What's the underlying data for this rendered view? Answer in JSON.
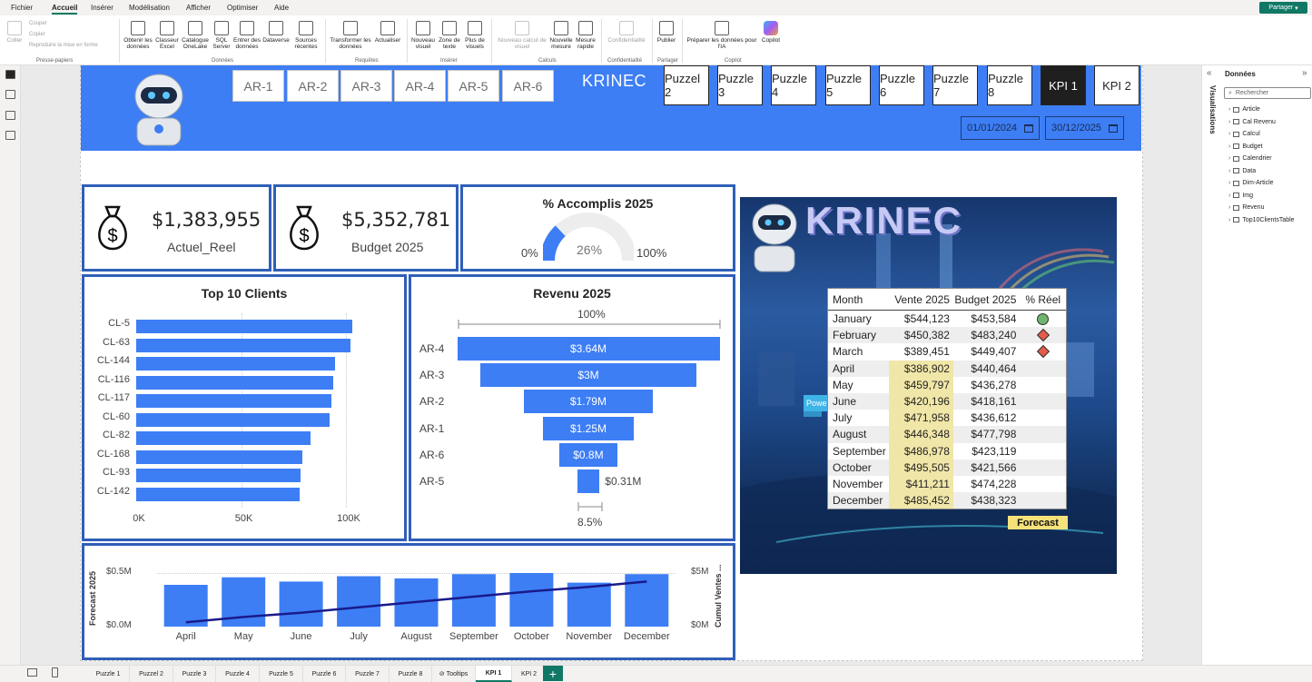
{
  "menu": {
    "items": [
      {
        "label": "Fichier",
        "active": false
      },
      {
        "label": "Accueil",
        "active": true
      },
      {
        "label": "Insérer",
        "active": false
      },
      {
        "label": "Modélisation",
        "active": false
      },
      {
        "label": "Afficher",
        "active": false
      },
      {
        "label": "Optimiser",
        "active": false
      },
      {
        "label": "Aide",
        "active": false
      }
    ],
    "share_label": "Partager"
  },
  "ribbon": {
    "paste": "Coller",
    "cut": "Couper",
    "copy": "Copier",
    "format_painter": "Reproduire la mise en forme",
    "buttons": [
      {
        "label": "Obtenir les données",
        "icon": "database-icon"
      },
      {
        "label": "Classeur Excel",
        "icon": "excel-icon"
      },
      {
        "label": "Catalogue OneLake",
        "icon": "onelake-icon"
      },
      {
        "label": "SQL Server",
        "icon": "sql-icon"
      },
      {
        "label": "Entrer des données",
        "icon": "table-icon"
      },
      {
        "label": "Dataverse",
        "icon": "dataverse-icon"
      },
      {
        "label": "Sources récentes",
        "icon": "recent-icon"
      },
      {
        "label": "Transformer les données",
        "icon": "transform-icon"
      },
      {
        "label": "Actualiser",
        "icon": "refresh-icon"
      },
      {
        "label": "Nouveau visuel",
        "icon": "chart-icon"
      },
      {
        "label": "Zone de texte",
        "icon": "textbox-icon"
      },
      {
        "label": "Plus de visuels",
        "icon": "more-visuals-icon"
      },
      {
        "label": "Nouveau calcul de visuel",
        "icon": "calc-icon"
      },
      {
        "label": "Nouvelle mesure",
        "icon": "measure-icon"
      },
      {
        "label": "Mesure rapide",
        "icon": "quick-measure-icon"
      },
      {
        "label": "Confidentialité",
        "icon": "shield-icon"
      },
      {
        "label": "Publier",
        "icon": "publish-icon"
      },
      {
        "label": "Préparer les données pour l'IA",
        "icon": "ai-prep-icon"
      },
      {
        "label": "Copilot",
        "icon": "copilot-icon"
      }
    ],
    "groups": [
      "Presse-papiers",
      "Données",
      "Requêtes",
      "Insérer",
      "Calculs",
      "Confidentialité",
      "Partager",
      "Copilot"
    ]
  },
  "header": {
    "ar_buttons": [
      "AR-1",
      "AR-2",
      "AR-3",
      "AR-4",
      "AR-5",
      "AR-6"
    ],
    "brand": "KRINEC",
    "nav_buttons": [
      "Puzzel 2",
      "Puzzle 3",
      "Puzzle 4",
      "Puzzle 5",
      "Puzzle 6",
      "Puzzle 7",
      "Puzzle 8",
      "KPI 1",
      "KPI 2"
    ],
    "active_nav": "KPI 1",
    "date_start": "01/01/2024",
    "date_end": "30/12/2025"
  },
  "cards": {
    "actual_value": "$1,383,955",
    "actual_label": "Actuel_Reel",
    "budget_value": "$5,352,781",
    "budget_label": "Budget 2025"
  },
  "gauge": {
    "title": "% Accomplis 2025",
    "min_label": "0%",
    "max_label": "100%",
    "value_label": "26%",
    "value_fraction": 0.26
  },
  "image_panel": {
    "brand": "KRINEC",
    "forecast_label": "Forecast",
    "power_label": "Powe"
  },
  "table": {
    "headers": [
      "Month",
      "Vente 2025",
      "Budget 2025",
      "% Réel"
    ],
    "rows": [
      {
        "month": "January",
        "vente": "$544,123",
        "budget": "$453,584",
        "indicator": "green-circle",
        "highlight": false
      },
      {
        "month": "February",
        "vente": "$450,382",
        "budget": "$483,240",
        "indicator": "red-diamond",
        "highlight": false
      },
      {
        "month": "March",
        "vente": "$389,451",
        "budget": "$449,407",
        "indicator": "red-diamond",
        "highlight": false
      },
      {
        "month": "April",
        "vente": "$386,902",
        "budget": "$440,464",
        "indicator": "",
        "highlight": true
      },
      {
        "month": "May",
        "vente": "$459,797",
        "budget": "$436,278",
        "indicator": "",
        "highlight": true
      },
      {
        "month": "June",
        "vente": "$420,196",
        "budget": "$418,161",
        "indicator": "",
        "highlight": true
      },
      {
        "month": "July",
        "vente": "$471,958",
        "budget": "$436,612",
        "indicator": "",
        "highlight": true
      },
      {
        "month": "August",
        "vente": "$446,348",
        "budget": "$477,798",
        "indicator": "",
        "highlight": true
      },
      {
        "month": "September",
        "vente": "$486,978",
        "budget": "$423,119",
        "indicator": "",
        "highlight": true
      },
      {
        "month": "October",
        "vente": "$495,505",
        "budget": "$421,566",
        "indicator": "",
        "highlight": true
      },
      {
        "month": "November",
        "vente": "$411,211",
        "budget": "$474,228",
        "indicator": "",
        "highlight": true
      },
      {
        "month": "December",
        "vente": "$485,452",
        "budget": "$438,323",
        "indicator": "",
        "highlight": true
      }
    ]
  },
  "chart_data": [
    {
      "type": "bar",
      "orientation": "horizontal",
      "title": "Top 10 Clients",
      "categories": [
        "CL-5",
        "CL-63",
        "CL-144",
        "CL-116",
        "CL-117",
        "CL-60",
        "CL-82",
        "CL-168",
        "CL-93",
        "CL-142"
      ],
      "values": [
        103000,
        102000,
        95000,
        94000,
        93000,
        92000,
        83000,
        79000,
        78500,
        78000
      ],
      "xlim": [
        0,
        100000
      ],
      "xticks": [
        "0K",
        "50K",
        "100K"
      ]
    },
    {
      "type": "bar",
      "orientation": "funnel",
      "title": "Revenu 2025",
      "categories": [
        "AR-4",
        "AR-3",
        "AR-2",
        "AR-1",
        "AR-6",
        "AR-5"
      ],
      "values": [
        3.64,
        3.0,
        1.79,
        1.25,
        0.8,
        0.31
      ],
      "labels": [
        "$3.64M",
        "$3M",
        "$1.79M",
        "$1.25M",
        "$0.8M",
        "$0.31M"
      ],
      "top_percent": "100%",
      "bottom_percent": "8.5%"
    },
    {
      "type": "bar",
      "title": "",
      "categories": [
        "April",
        "May",
        "June",
        "July",
        "August",
        "September",
        "October",
        "November",
        "December"
      ],
      "series": [
        {
          "name": "Forecast 2025",
          "values": [
            0.39,
            0.46,
            0.42,
            0.47,
            0.45,
            0.49,
            0.5,
            0.41,
            0.49
          ]
        },
        {
          "name": "Cumul Ventes ...",
          "values": [
            0.4,
            0.9,
            1.3,
            1.8,
            2.3,
            2.8,
            3.3,
            3.7,
            4.2
          ]
        }
      ],
      "ylabel": "Forecast 2025",
      "y2label": "Cumul Ventes ...",
      "yticks": [
        "$0.0M",
        "$0.5M"
      ],
      "y2ticks": [
        "$0M",
        "$5M"
      ],
      "ylim": [
        0,
        0.5
      ],
      "y2lim": [
        0,
        5
      ]
    }
  ],
  "right_pane": {
    "vertical_label": "Visualisations",
    "title": "Données",
    "search_placeholder": "Rechercher",
    "fields": [
      "Article",
      "Cal Revenu",
      "Calcul",
      "Budget",
      "Calendrier",
      "Data",
      "Dim-Article",
      "Img",
      "Revenu",
      "Top10ClientsTable"
    ]
  },
  "tabs": {
    "items": [
      "Puzzle 1",
      "Puzzel 2",
      "Puzzle 3",
      "Puzzle 4",
      "Puzzle 5",
      "Puzzle 6",
      "Puzzle 7",
      "Puzzle 8",
      "Tooltips",
      "KPI 1",
      "KPI 2"
    ],
    "active": "KPI 1",
    "add_label": "+"
  },
  "colors": {
    "accent": "#3d7ef5",
    "border": "#2f5fb8",
    "brand_green": "#117865"
  }
}
